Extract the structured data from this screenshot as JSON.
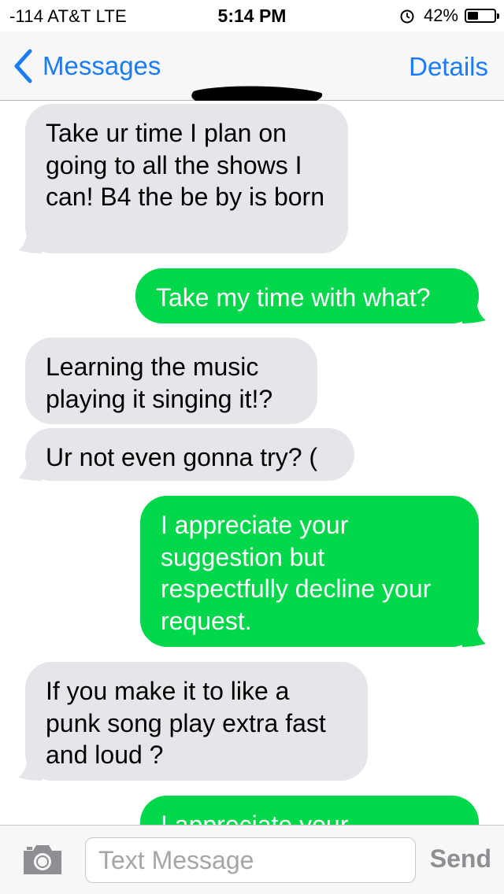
{
  "status_bar": {
    "carrier": "-114 AT&T  LTE",
    "time": "5:14 PM",
    "battery_percent": "42%",
    "battery_level": 0.42,
    "icons": [
      "alarm-clock-icon",
      "battery-icon"
    ]
  },
  "nav": {
    "back_label": "Messages",
    "back_icon": "chevron-left-icon",
    "details_label": "Details",
    "contact_name_redacted": true,
    "accent_color": "#1a7cf6"
  },
  "colors": {
    "incoming_bubble": "#e5e5ea",
    "outgoing_bubble": "#00d74a",
    "incoming_text": "#000000",
    "outgoing_text": "#ffffff"
  },
  "messages": [
    {
      "direction": "incoming",
      "text": "Take ur time I plan on going to all the shows I can!  B4 the be by is born",
      "tail": true
    },
    {
      "direction": "outgoing",
      "text": "Take my time with what?",
      "tail": true
    },
    {
      "direction": "incoming",
      "text": "Learning the music playing it singing it!?",
      "tail": false
    },
    {
      "direction": "incoming",
      "text": "Ur not even gonna try? (",
      "tail": true
    },
    {
      "direction": "outgoing",
      "text": "I appreciate your suggestion but respectfully decline your request.",
      "tail": true
    },
    {
      "direction": "incoming",
      "text": "If you make it to like a punk song play extra fast and loud ?",
      "tail": true
    },
    {
      "direction": "outgoing",
      "text": "I appreciate your",
      "tail": false
    }
  ],
  "input_bar": {
    "camera_icon": "camera-icon",
    "placeholder": "Text Message",
    "value": "",
    "send_label": "Send"
  }
}
